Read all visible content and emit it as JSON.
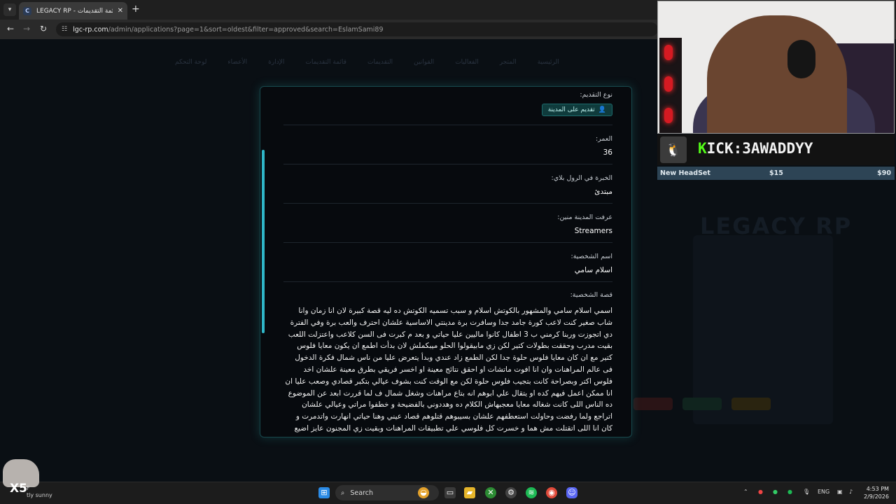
{
  "browser": {
    "tab_title": "LEGACY RP - قائمة التقديمات",
    "tab_favicon": "C",
    "url_host": "lgc-rp.com",
    "url_path": "/admin/applications?page=1&sort=oldest&filter=approved&search=EslamSami89"
  },
  "background": {
    "nav_items": [
      "الرئيسية",
      "المتجر",
      "الفعاليات",
      "القوانين",
      "التقديمات",
      "قائمة التقديمات",
      "الإدارة",
      "الأعضاء",
      "لوحة التحكم"
    ],
    "logo_text": "LEGACY RP"
  },
  "application": {
    "type_label": "نوع التقديم:",
    "type_value": "تقديم على المدينة",
    "age_label": "العمر:",
    "age_value": "36",
    "experience_label": "الخبرة في الرول بلاي:",
    "experience_value": "مبتدئ",
    "source_label": "عرفت المدينة منين:",
    "source_value": "Streamers",
    "character_name_label": "اسم الشخصية:",
    "character_name_value": "اسلام سامي",
    "story_label": "قصة الشخصية:",
    "story_value": "اسمي اسلام سامي والمشهور بالكوتش اسلام و سبب تسميه الكوتش ده ليه قصة كبيرة لان انا زمان وانا شاب صغير كنت لاعب كورة جامد جدا وسافرت برة مدينتي الاساسية علشان احترف والعب برة وفي الفترة دي اتجوزت وربنا كرمني ب 3 اطفال كانوا ماليين عليا حياتي و بعد م كبرت فى السن كلاعب واعتزلت اللعب بقيت مدرب وحققت بطولات كتير لكن زي مابيقولوا الحلو ميبكملش لان بدأت اطمع ان يكون معايا فلوس كتير مع ان كان معايا فلوس حلوة جدا لكن الطمع زاد عندي وبدأ يتعرض عليا من ناس شمال فكرة الدخول فى عالم المراهنات وان انا افوت ماتشات او احقق نتائج معينة او اخسر فريقي بطرق معينة علشان اخد فلوس اكتر وبصراحة كانت بتجيب فلوس حلوة لكن مع الوقت كنت بشوف عيالي بتكبر قصادي وصعب عليا ان انا ممكن اعمل فيهم كده او يتقال علي ابوهم انه بتاع مراهنات وشغل شمال ف لما قررت ابعد عن الموضوع ده الناس اللى كانت شغاله معايا معجبهاش الكلام ده وهددوني بالفضيحة و خطفوا مراتي وعيالي علشان اتراجع ولما رفضت وحاولت استعطفهم علشان بسيبوهم قتلوهم قصاد عيني وهنا حياتي انهارت واتدمرت و كان انا اللى اتقتلت مش هما و خسرت كل فلوسي علي تطبيقات المراهنات وبقيت زي المجنون عايز اضيع كل الفلوس اللى"
  },
  "stream_overlay": {
    "kick_prefix": "K",
    "kick_rest": "ICK:3AWADDYY",
    "goal_name": "New HeadSet",
    "goal_current": "$15",
    "goal_target": "$90"
  },
  "taskbar": {
    "weather_text_1": "F",
    "weather_text_2": "tly sunny",
    "search_label": "Search",
    "lang": "ENG",
    "time": "4:53 PM",
    "date": "2/9/2026"
  }
}
